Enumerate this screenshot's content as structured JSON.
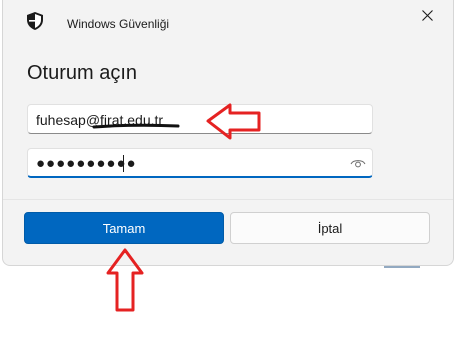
{
  "window": {
    "app_title": "Windows Güvenliği",
    "close_icon": "close-icon",
    "shield_icon": "shield-icon"
  },
  "heading": "Oturum açın",
  "email_field": {
    "value": "fuhesap@firat.edu.tr"
  },
  "password_field": {
    "value": "●●●●●●●●●●",
    "reveal_icon": "eye-icon"
  },
  "buttons": {
    "ok_label": "Tamam",
    "cancel_label": "İptal"
  },
  "colors": {
    "accent": "#0067c0",
    "annotation": "#e52222",
    "dialog_bg": "#f3f3f3"
  }
}
